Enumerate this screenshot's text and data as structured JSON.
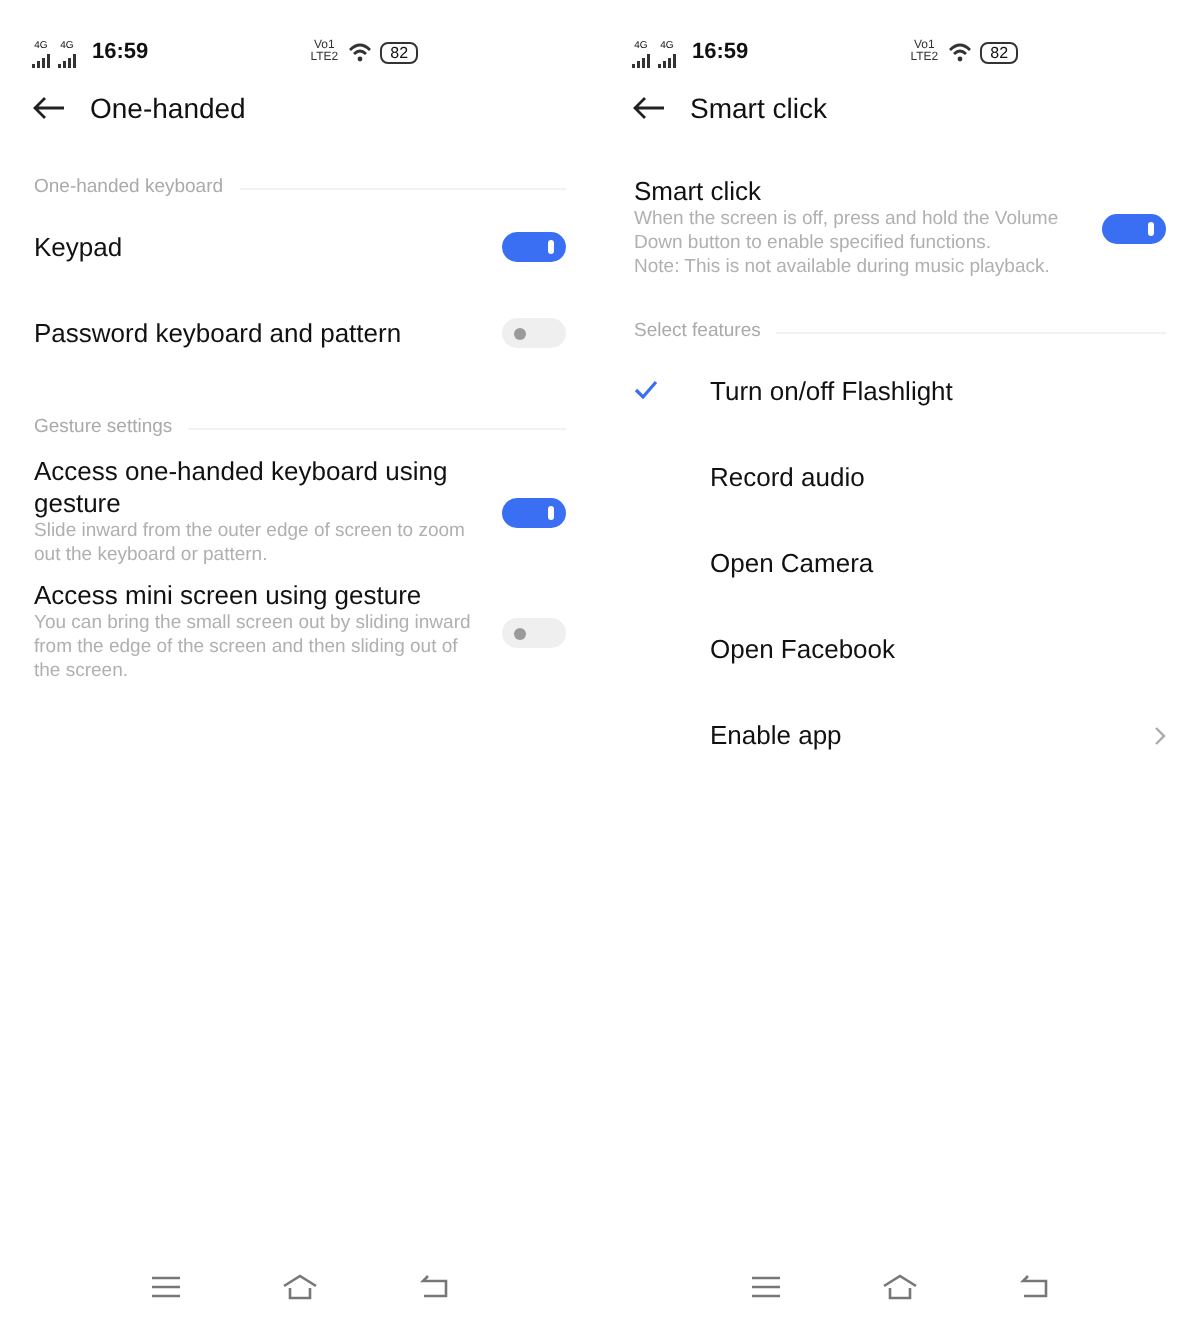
{
  "screens": [
    {
      "status_bar": {
        "network": [
          "4G",
          "4G"
        ],
        "time": "16:59",
        "volte": "Vo1 LTE2",
        "battery": "82"
      },
      "header": {
        "title": "One-handed"
      },
      "sections": [
        {
          "heading": "One-handed keyboard",
          "items": [
            {
              "kind": "switch",
              "title": "Keypad",
              "on": true
            },
            {
              "kind": "switch",
              "title": "Password keyboard and pattern",
              "on": false
            }
          ]
        },
        {
          "heading": "Gesture settings",
          "items": [
            {
              "kind": "switch",
              "title": "Access one-handed keyboard using gesture",
              "description": "Slide inward from the outer edge of screen to zoom out the keyboard or pattern.",
              "on": true
            },
            {
              "kind": "switch",
              "title": "Access mini screen using gesture",
              "description": "You can bring the small screen out by sliding inward from the edge of the screen and then sliding out of the screen.",
              "on": false
            }
          ]
        }
      ]
    },
    {
      "status_bar": {
        "network": [
          "4G",
          "4G"
        ],
        "time": "16:59",
        "volte": "Vo1 LTE2",
        "battery": "82"
      },
      "header": {
        "title": "Smart click"
      },
      "sections": [
        {
          "items": [
            {
              "kind": "switch",
              "title": "Smart click",
              "description": "When the screen is off, press and hold the Volume Down button to enable specified functions.\nNote: This is not available during music playback.",
              "on": true
            }
          ]
        },
        {
          "heading": "Select features",
          "items": [
            {
              "kind": "option",
              "title": "Turn on/off Flashlight",
              "selected": true
            },
            {
              "kind": "option",
              "title": "Record audio",
              "selected": false
            },
            {
              "kind": "option",
              "title": "Open Camera",
              "selected": false
            },
            {
              "kind": "option",
              "title": "Open Facebook",
              "selected": false
            },
            {
              "kind": "link",
              "title": "Enable app"
            }
          ]
        }
      ]
    }
  ]
}
